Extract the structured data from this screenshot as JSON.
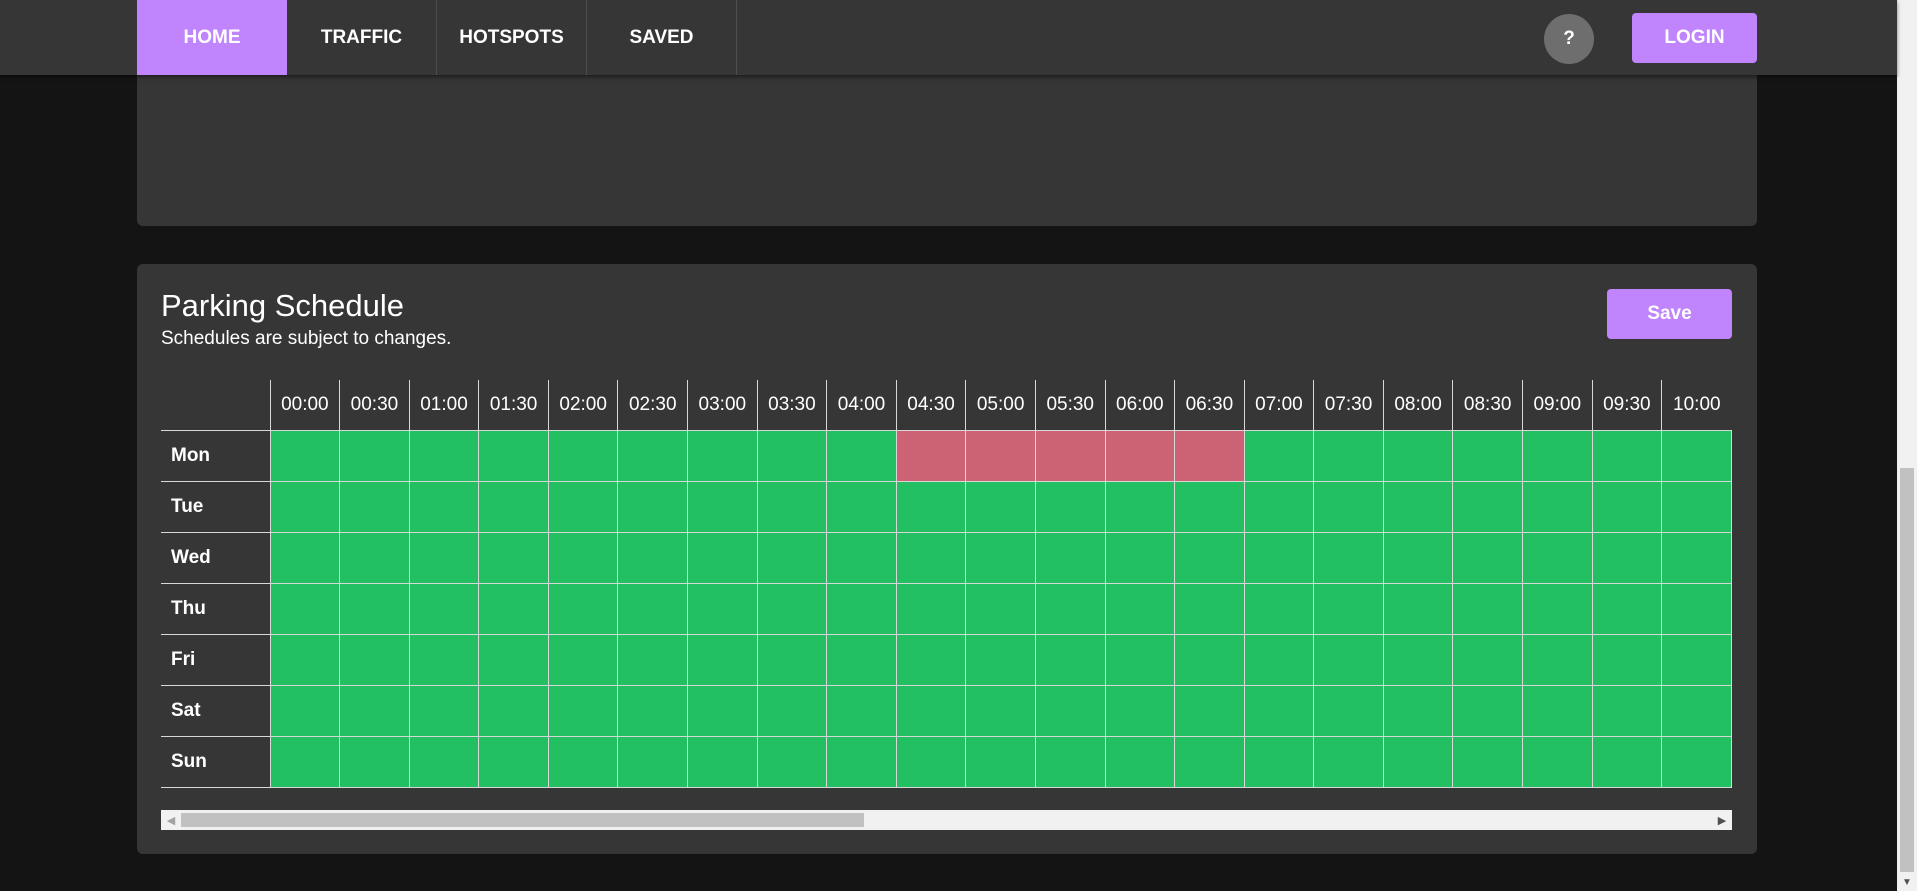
{
  "nav": {
    "items": [
      {
        "label": "HOME",
        "active": true
      },
      {
        "label": "TRAFFIC",
        "active": false
      },
      {
        "label": "HOTSPOTS",
        "active": false
      },
      {
        "label": "SAVED",
        "active": false
      }
    ],
    "help_label": "?",
    "login_label": "LOGIN"
  },
  "schedule": {
    "title": "Parking Schedule",
    "subtitle": "Schedules are subject to changes.",
    "save_label": "Save",
    "times": [
      "00:00",
      "00:30",
      "01:00",
      "01:30",
      "02:00",
      "02:30",
      "03:00",
      "03:30",
      "04:00",
      "04:30",
      "05:00",
      "05:30",
      "06:00",
      "06:30",
      "07:00",
      "07:30",
      "08:00",
      "08:30",
      "09:00",
      "09:30",
      "10:00"
    ],
    "days": [
      "Mon",
      "Tue",
      "Wed",
      "Thu",
      "Fri",
      "Sat",
      "Sun"
    ],
    "busy_slots": {
      "Mon": [
        "04:30",
        "05:00",
        "05:30",
        "06:00",
        "06:30"
      ]
    }
  },
  "colors": {
    "accent": "#c084fc",
    "available": "#22c063",
    "unavailable": "#cb6375",
    "panel": "#363636",
    "background": "#141414"
  },
  "icons": {
    "scroll_left": "arrow-left-icon",
    "scroll_right": "arrow-right-icon",
    "scroll_down": "arrow-down-icon"
  }
}
